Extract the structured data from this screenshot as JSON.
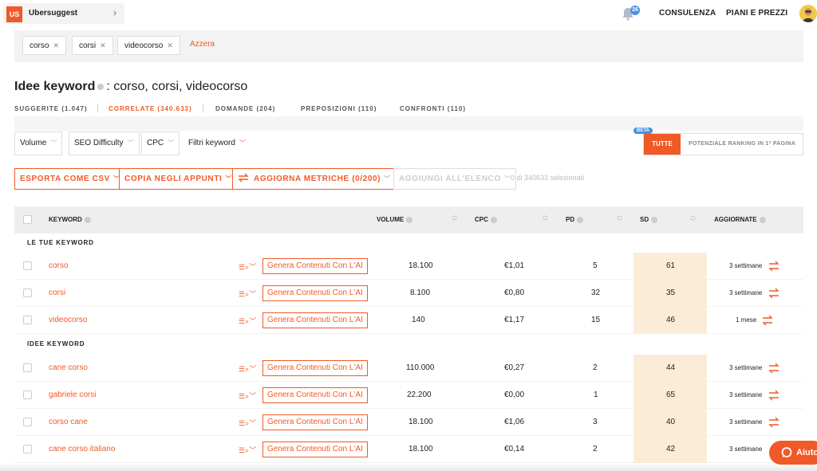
{
  "header": {
    "project_logo": "US",
    "project_name": "Ubersuggest",
    "notification_count": "26",
    "nav": [
      "CONSULENZA",
      "PIANI E PREZZI"
    ]
  },
  "chips": {
    "items": [
      "corso",
      "corsi",
      "videocorso"
    ],
    "clear_label": "Azzera"
  },
  "page": {
    "title_bold": "Idee keyword",
    "title_rest": ": corso, corsi, videocorso"
  },
  "tabs": [
    {
      "label": "SUGGERITE (1.047)",
      "active": false
    },
    {
      "label": "CORRELATE (340.633)",
      "active": true
    },
    {
      "label": "DOMANDE (204)",
      "active": false
    },
    {
      "label": "PREPOSIZIONI (110)",
      "active": false
    },
    {
      "label": "CONFRONTI (110)",
      "active": false
    }
  ],
  "filters": {
    "volume": "Volume",
    "seo_difficulty": "SEO Difficulty",
    "cpc": "CPC",
    "keyword_filter": "Filtri keyword",
    "beta": "BETA",
    "all": "TUTTE",
    "potential": "POTENZIALE RANKING IN 1ª PAGINA"
  },
  "actions": {
    "export_csv": "ESPORTA COME CSV",
    "copy_clipboard": "COPIA NEGLI APPUNTI",
    "refresh_metrics": "AGGIORNA METRICHE (0/200)",
    "add_to_list": "AGGIUNGI ALL'ELENCO",
    "selection_count": "0 di 340633 selezionati"
  },
  "table": {
    "columns": [
      "KEYWORD",
      "VOLUME",
      "CPC",
      "PD",
      "SD",
      "AGGIORNATE"
    ],
    "section_yours": "LE TUE KEYWORD",
    "section_ideas": "IDEE KEYWORD",
    "generate_label": "Genera Contenuti Con L'AI",
    "your_rows": [
      {
        "keyword": "corso",
        "volume": "18.100",
        "cpc": "€1,01",
        "pd": "5",
        "sd": "61",
        "updated": "3 settimane"
      },
      {
        "keyword": "corsi",
        "volume": "8.100",
        "cpc": "€0,80",
        "pd": "32",
        "sd": "35",
        "updated": "3 settimane"
      },
      {
        "keyword": "videocorso",
        "volume": "140",
        "cpc": "€1,17",
        "pd": "15",
        "sd": "46",
        "updated": "1 mese"
      }
    ],
    "idea_rows": [
      {
        "keyword": "cane corso",
        "volume": "110.000",
        "cpc": "€0,27",
        "pd": "2",
        "sd": "44",
        "updated": "3 settimane"
      },
      {
        "keyword": "gabriele corsi",
        "volume": "22.200",
        "cpc": "€0,00",
        "pd": "1",
        "sd": "65",
        "updated": "3 settimane"
      },
      {
        "keyword": "corso cane",
        "volume": "18.100",
        "cpc": "€1,06",
        "pd": "3",
        "sd": "40",
        "updated": "3 settimane"
      },
      {
        "keyword": "cane corso italiano",
        "volume": "18.100",
        "cpc": "€0,14",
        "pd": "2",
        "sd": "42",
        "updated": "3 settimane"
      }
    ]
  },
  "help": {
    "label": "Aiuto"
  },
  "colors": {
    "accent": "#f05a28",
    "sd_highlight": "#fbecd8",
    "info_blue": "#4a90e2"
  }
}
